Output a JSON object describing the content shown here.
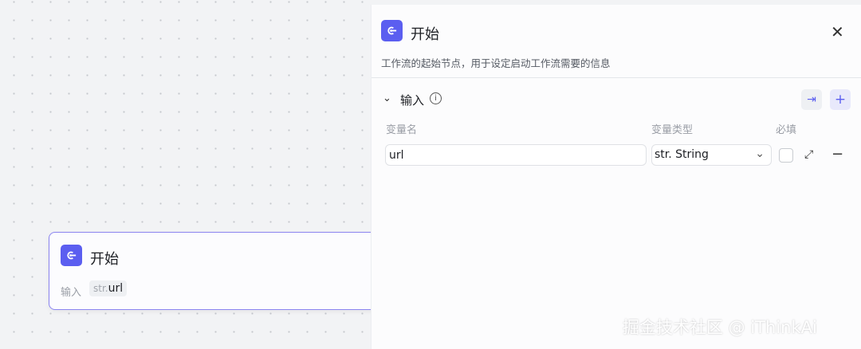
{
  "canvas": {
    "node": {
      "title": "开始",
      "input_label": "输入",
      "tag_type": "str.",
      "tag_name": "url"
    }
  },
  "panel": {
    "title": "开始",
    "description": "工作流的起始节点，用于设定启动工作流需要的信息",
    "section": {
      "title": "输入",
      "columns": [
        "变量名",
        "变量类型",
        "必填"
      ],
      "rows": [
        {
          "name": "url",
          "type": "str. String",
          "required": false
        }
      ]
    }
  },
  "watermark": "掘金技术社区 @ iThinkAi",
  "colors": {
    "accent": "#5b5ef0"
  }
}
